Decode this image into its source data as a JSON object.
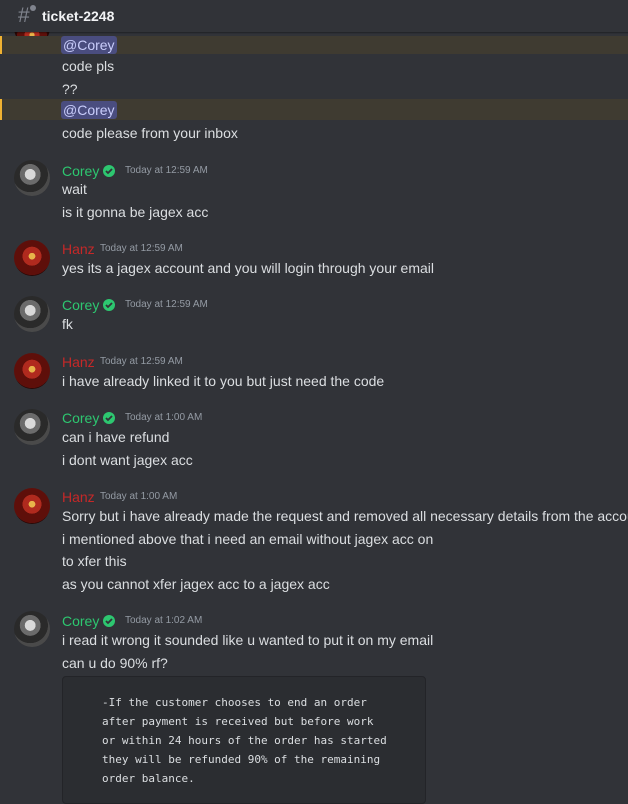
{
  "channel": {
    "name": "ticket-2248"
  },
  "colors": {
    "background": "#313338",
    "corey": "#2dc770",
    "hanz": "#c62828",
    "mention_bg": "#4a4d7f",
    "highlight": "#f0b232"
  },
  "top_messages": [
    {
      "mention": "@Corey",
      "text": "code pls"
    },
    {
      "text": "??"
    },
    {
      "mention": "@Corey",
      "text": "code please from your inbox"
    }
  ],
  "messages": [
    {
      "author": "Corey",
      "time": "Today at 12:59 AM",
      "lines": [
        "wait",
        "is it gonna be jagex acc"
      ]
    },
    {
      "author": "Hanz",
      "time": "Today at 12:59 AM",
      "lines": [
        "yes its a jagex account and you will login through your email"
      ]
    },
    {
      "author": "Corey",
      "time": "Today at 12:59 AM",
      "lines": [
        "fk"
      ]
    },
    {
      "author": "Hanz",
      "time": "Today at 12:59 AM",
      "lines": [
        "i have already linked it to you but just need the code"
      ]
    },
    {
      "author": "Corey",
      "time": "Today at 1:00 AM",
      "lines": [
        "can i have refund",
        "i dont want jagex acc"
      ]
    },
    {
      "author": "Hanz",
      "time": "Today at 1:00 AM",
      "lines": [
        "Sorry but i have already made the request and removed all necessary details from the account",
        "i mentioned above that i need an email without jagex acc on",
        "to xfer this",
        "as you cannot xfer jagex acc to a jagex acc"
      ]
    },
    {
      "author": "Corey",
      "time": "Today at 1:02 AM",
      "lines": [
        "i read it wrong it sounded like u wanted to put it on my email",
        "can u do 90% rf?"
      ]
    }
  ],
  "code_block": {
    "lines": [
      "-If the customer chooses to end an order",
      "after payment is received but before work",
      "or within 24 hours of the order has started",
      "they will be refunded 90% of the remaining",
      "order balance."
    ]
  },
  "icons": {
    "channel": "hashtag-icon",
    "badge": "verified-badge-icon"
  }
}
